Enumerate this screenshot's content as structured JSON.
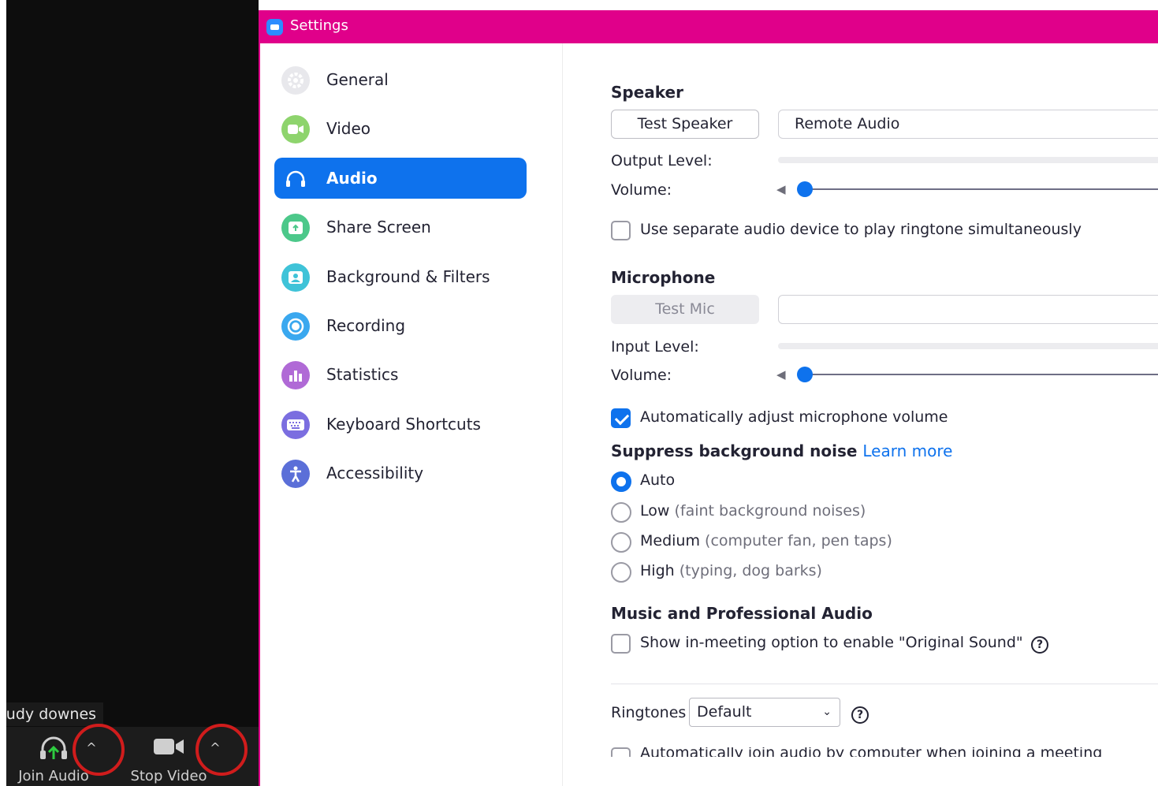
{
  "meeting": {
    "participant_name": "rudy downes",
    "toolbar": {
      "join_audio_label": "Join Audio",
      "stop_video_label": "Stop Video",
      "caret_glyph": "^"
    }
  },
  "window": {
    "title": "Settings",
    "title_bar_color": "#e0008a"
  },
  "sidebar": {
    "items": [
      {
        "label": "General",
        "icon": "gear-icon",
        "color": "#e8e8ec"
      },
      {
        "label": "Video",
        "icon": "video-camera-icon",
        "color": "#8ed46d"
      },
      {
        "label": "Audio",
        "icon": "headphones-icon",
        "color": "#0e72ed"
      },
      {
        "label": "Share Screen",
        "icon": "share-screen-icon",
        "color": "#4cc88a"
      },
      {
        "label": "Background & Filters",
        "icon": "background-icon",
        "color": "#3fc3d8"
      },
      {
        "label": "Recording",
        "icon": "record-icon",
        "color": "#3aa8ef"
      },
      {
        "label": "Statistics",
        "icon": "chart-icon",
        "color": "#b06ad6"
      },
      {
        "label": "Keyboard Shortcuts",
        "icon": "keyboard-icon",
        "color": "#7b6ee0"
      },
      {
        "label": "Accessibility",
        "icon": "accessibility-icon",
        "color": "#5b6fd8"
      }
    ],
    "active_index": 2
  },
  "audio": {
    "speaker": {
      "heading": "Speaker",
      "test_button": "Test Speaker",
      "device": "Remote Audio",
      "output_level_label": "Output Level:",
      "volume_label": "Volume:",
      "volume_level": 0.02
    },
    "separate_ringtone": {
      "label": "Use separate audio device to play ringtone simultaneously",
      "checked": false
    },
    "microphone": {
      "heading": "Microphone",
      "test_button": "Test Mic",
      "device": "",
      "input_level_label": "Input Level:",
      "volume_label": "Volume:",
      "volume_level": 0.02
    },
    "auto_adjust": {
      "label": "Automatically adjust microphone volume",
      "checked": true
    },
    "suppress": {
      "heading": "Suppress background noise",
      "learn_more": "Learn more",
      "options": [
        {
          "label": "Auto",
          "hint": "",
          "selected": true
        },
        {
          "label": "Low",
          "hint": "(faint background noises)",
          "selected": false
        },
        {
          "label": "Medium",
          "hint": "(computer fan, pen taps)",
          "selected": false
        },
        {
          "label": "High",
          "hint": "(typing, dog barks)",
          "selected": false
        }
      ]
    },
    "music": {
      "heading": "Music and Professional Audio",
      "original_sound_label": "Show in-meeting option to enable \"Original Sound\"",
      "checked": false,
      "help_glyph": "?"
    },
    "ringtones": {
      "label": "Ringtones",
      "value": "Default",
      "chevron": "⌄"
    },
    "auto_join": {
      "label": "Automatically join audio by computer when joining a meeting",
      "checked": false
    }
  }
}
